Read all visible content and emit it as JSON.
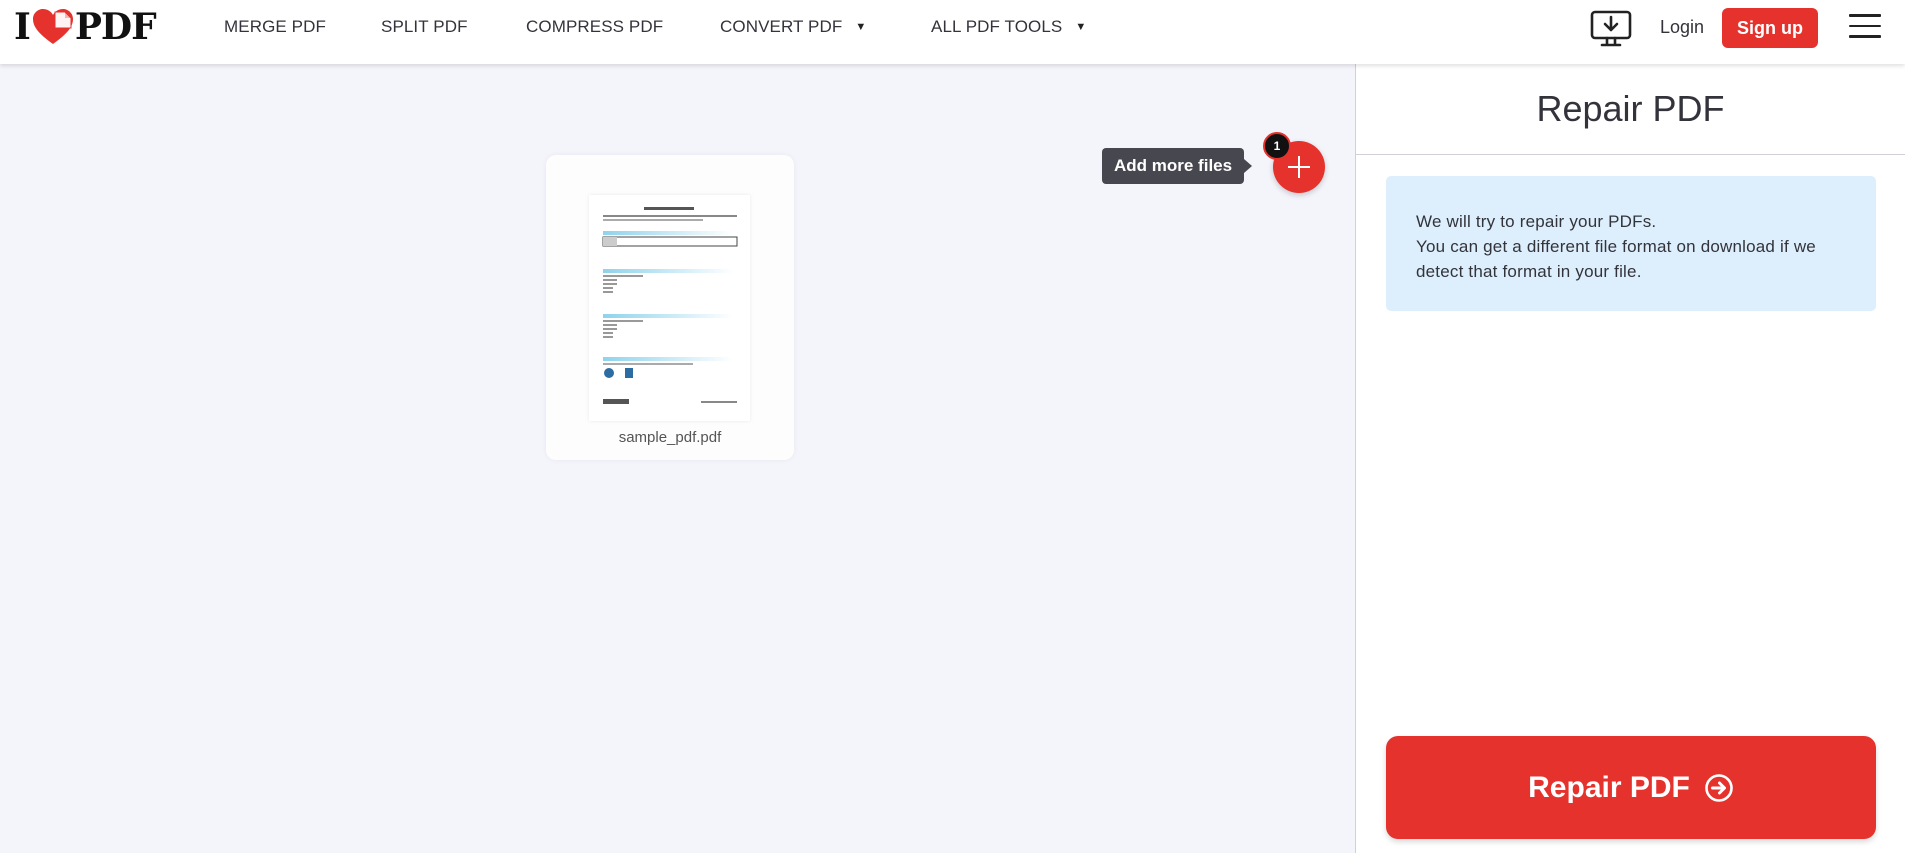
{
  "header": {
    "logo": {
      "prefix": "I",
      "suffix": "PDF",
      "icon": "heart-icon"
    },
    "nav": [
      {
        "label": "MERGE PDF",
        "has_dropdown": false
      },
      {
        "label": "SPLIT PDF",
        "has_dropdown": false
      },
      {
        "label": "COMPRESS PDF",
        "has_dropdown": false
      },
      {
        "label": "CONVERT PDF",
        "has_dropdown": true
      },
      {
        "label": "ALL PDF TOOLS",
        "has_dropdown": true
      }
    ],
    "dropdown_caret": "▼",
    "desktop_icon": "desktop-download-icon",
    "login_label": "Login",
    "signup_label": "Sign up",
    "menu_icon": "hamburger-menu-icon"
  },
  "workspace": {
    "files": [
      {
        "name": "sample_pdf.pdf"
      }
    ],
    "add_more_tooltip": "Add more files",
    "file_count_badge": "1",
    "add_icon": "plus-icon"
  },
  "sidebar": {
    "title": "Repair PDF",
    "info_lines": [
      "We will try to repair your PDFs.",
      "You can get a different file format on download if we detect that format in your file."
    ],
    "action_label": "Repair PDF",
    "action_icon": "arrow-right-circle-icon"
  },
  "colors": {
    "brand_red": "#e5322d",
    "info_bg": "#ddeffc",
    "workspace_bg": "#f4f4fb",
    "tooltip_bg": "#47474f"
  }
}
